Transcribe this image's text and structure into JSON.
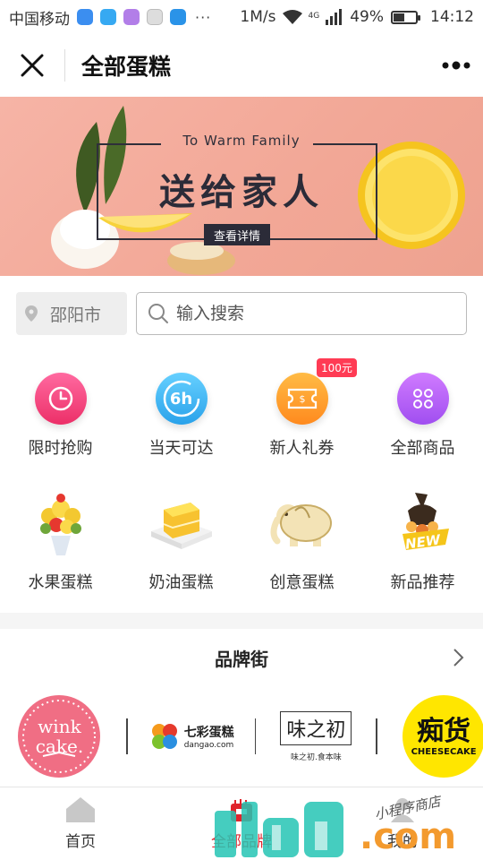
{
  "status_bar": {
    "carrier": "中国移动",
    "net_speed": "1M/s",
    "network_type": "4G",
    "battery": "49%",
    "battery_level": 0.49,
    "time": "14:12",
    "dots": "···"
  },
  "nav": {
    "title": "全部蛋糕"
  },
  "banner": {
    "subtitle": "To Warm Family",
    "title": "送给家人",
    "button": "查看详情"
  },
  "search": {
    "city": "邵阳市",
    "placeholder": "输入搜索"
  },
  "categories": [
    {
      "label": "限时抢购",
      "icon": "clock-icon",
      "color": "#f2467e"
    },
    {
      "label": "当天可达",
      "icon": "6h-icon",
      "icon_text": "6h",
      "color": "#3cb4f0"
    },
    {
      "label": "新人礼券",
      "icon": "coupon-icon",
      "color": "#ff9a2e",
      "badge": "100元"
    },
    {
      "label": "全部商品",
      "icon": "grid-dots-icon",
      "color": "#b05af0"
    }
  ],
  "cakes": [
    {
      "label": "水果蛋糕",
      "icon": "fruit-bouquet-icon"
    },
    {
      "label": "奶油蛋糕",
      "icon": "cream-cake-icon"
    },
    {
      "label": "创意蛋糕",
      "icon": "elephant-cake-icon"
    },
    {
      "label": "新品推荐",
      "icon": "new-cupcake-icon",
      "tag": "NEW"
    }
  ],
  "brands": {
    "title": "品牌街",
    "logos": [
      {
        "name": "wink-cake-logo",
        "text_1": "wink",
        "text_2": "cake."
      },
      {
        "name": "qicai-dangao-logo",
        "text_1": "七彩蛋糕",
        "text_2": "dangao.com"
      },
      {
        "name": "weizhichu-logo",
        "text_1": "味之初",
        "text_2": "味之初.食本味"
      },
      {
        "name": "chihuo-logo",
        "text_1": "痴货",
        "text_2": "CHEESECAKE"
      }
    ]
  },
  "tabbar": {
    "tabs": [
      {
        "label": "首页",
        "icon": "home-icon"
      },
      {
        "label": "全部品牌",
        "icon": "shop-icon"
      },
      {
        "label": "我的",
        "icon": "user-icon"
      }
    ],
    "active_index": 1
  },
  "watermark": {
    "text_small": "小程序商店",
    "text_big": ".com"
  },
  "colors": {
    "accent": "#e0242c",
    "banner_bg": "#f4ab9b"
  }
}
